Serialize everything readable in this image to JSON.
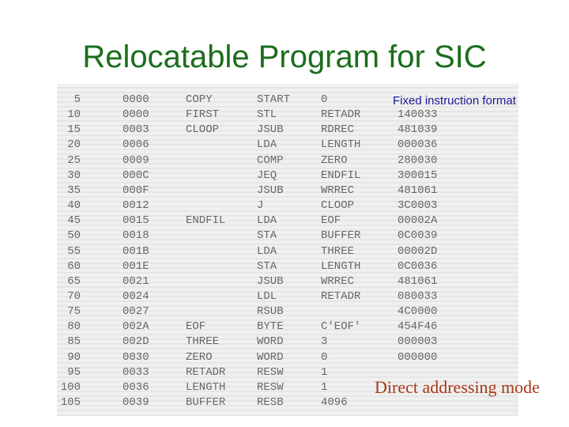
{
  "title": "Relocatable Program for SIC",
  "annotations": {
    "fixed_format": "Fixed instruction format",
    "direct_addressing": "Direct addressing mode"
  },
  "rows": [
    [
      "5",
      "0000",
      "COPY",
      "START",
      "0",
      ""
    ],
    [
      "10",
      "0000",
      "FIRST",
      "STL",
      "RETADR",
      "140033"
    ],
    [
      "15",
      "0003",
      "CLOOP",
      "JSUB",
      "RDREC",
      "481039"
    ],
    [
      "20",
      "0006",
      "",
      "LDA",
      "LENGTH",
      "000036"
    ],
    [
      "25",
      "0009",
      "",
      "COMP",
      "ZERO",
      "280030"
    ],
    [
      "30",
      "000C",
      "",
      "JEQ",
      "ENDFIL",
      "300015"
    ],
    [
      "35",
      "000F",
      "",
      "JSUB",
      "WRREC",
      "481061"
    ],
    [
      "40",
      "0012",
      "",
      "J",
      "CLOOP",
      "3C0003"
    ],
    [
      "45",
      "0015",
      "ENDFIL",
      "LDA",
      "EOF",
      "00002A"
    ],
    [
      "50",
      "0018",
      "",
      "STA",
      "BUFFER",
      "0C0039"
    ],
    [
      "55",
      "001B",
      "",
      "LDA",
      "THREE",
      "00002D"
    ],
    [
      "60",
      "001E",
      "",
      "STA",
      "LENGTH",
      "0C0036"
    ],
    [
      "65",
      "0021",
      "",
      "JSUB",
      "WRREC",
      "481061"
    ],
    [
      "70",
      "0024",
      "",
      "LDL",
      "RETADR",
      "080033"
    ],
    [
      "75",
      "0027",
      "",
      "RSUB",
      "",
      "4C0000"
    ],
    [
      "80",
      "002A",
      "EOF",
      "BYTE",
      "C'EOF'",
      "454F46"
    ],
    [
      "85",
      "002D",
      "THREE",
      "WORD",
      "3",
      "000003"
    ],
    [
      "90",
      "0030",
      "ZERO",
      "WORD",
      "0",
      "000000"
    ],
    [
      "95",
      "0033",
      "RETADR",
      "RESW",
      "1",
      ""
    ],
    [
      "100",
      "0036",
      "LENGTH",
      "RESW",
      "1",
      ""
    ],
    [
      "105",
      "0039",
      "BUFFER",
      "RESB",
      "4096",
      ""
    ]
  ]
}
